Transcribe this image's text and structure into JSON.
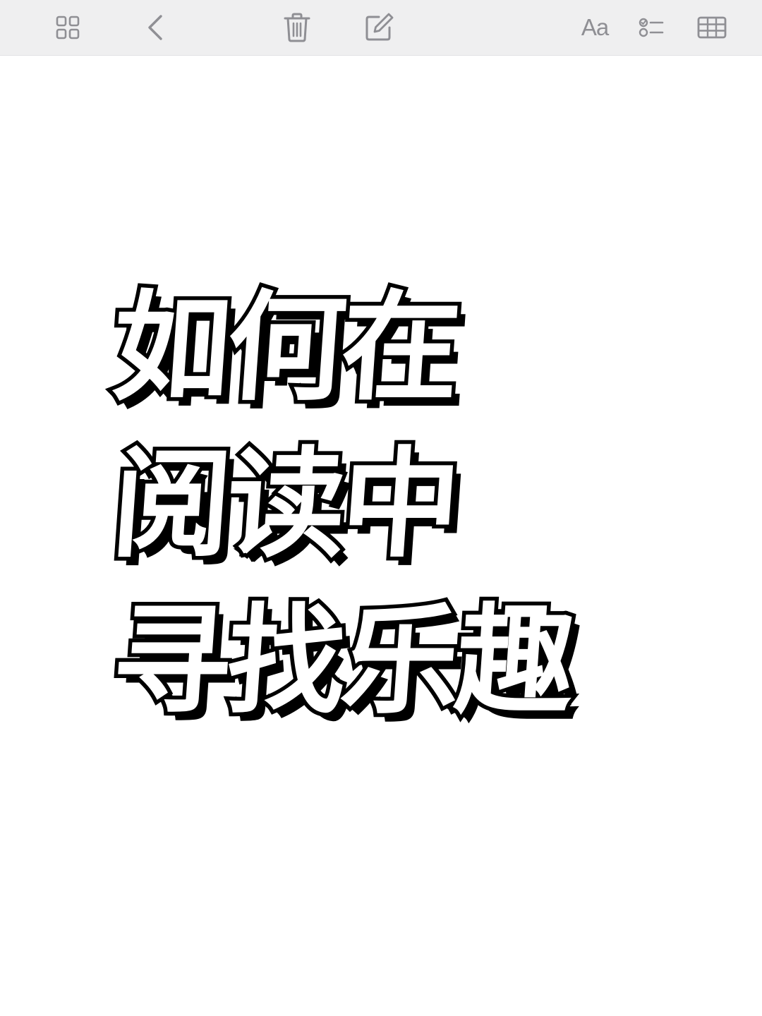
{
  "toolbar": {
    "left": [
      {
        "icon": "gallery-grid-icon",
        "label": ""
      },
      {
        "icon": "chevron-left-icon",
        "label": ""
      }
    ],
    "center": [
      {
        "icon": "trash-icon",
        "label": ""
      },
      {
        "icon": "compose-icon",
        "label": ""
      }
    ],
    "right": [
      {
        "icon": "text-format-icon",
        "label": "Aa"
      },
      {
        "icon": "checklist-icon",
        "label": ""
      },
      {
        "icon": "table-icon",
        "label": ""
      }
    ],
    "icon_color": "#8f8f94",
    "background": "#efeff0"
  },
  "note": {
    "lines": [
      "如何在",
      "阅读中",
      "寻找乐趣"
    ],
    "text_fill": "#ffffff",
    "outline_color": "#000000"
  }
}
